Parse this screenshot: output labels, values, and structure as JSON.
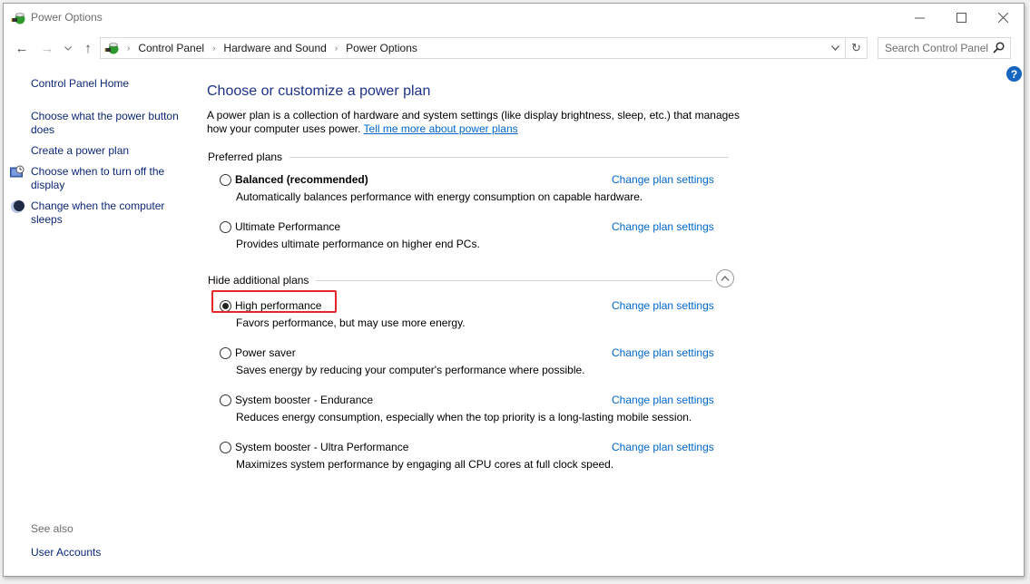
{
  "window": {
    "title": "Power Options",
    "controls": {
      "minimize": "—",
      "maximize": "☐",
      "close": "✕"
    }
  },
  "nav": {
    "back": "←",
    "forward": "→",
    "recent": "⌄",
    "up": "↑",
    "breadcrumb": [
      "Control Panel",
      "Hardware and Sound",
      "Power Options"
    ],
    "separator": "›",
    "dropdown": "⌄",
    "refresh": "↻",
    "search_placeholder": "Search Control Panel",
    "help": "?"
  },
  "sidebar": {
    "home": "Control Panel Home",
    "items": [
      {
        "label": "Choose what the power button does",
        "icon": null
      },
      {
        "label": "Create a power plan",
        "icon": null
      },
      {
        "label": "Choose when to turn off the display",
        "icon": "display-timer-icon"
      },
      {
        "label": "Change when the computer sleeps",
        "icon": "sleep-moon-icon"
      }
    ],
    "see_also": "See also",
    "see_also_links": [
      "User Accounts"
    ]
  },
  "main": {
    "title": "Choose or customize a power plan",
    "intro": "A power plan is a collection of hardware and system settings (like display brightness, sleep, etc.) that manages how your computer uses power.",
    "intro_link": "Tell me more about power plans",
    "preferred_header": "Preferred plans",
    "additional_header": "Hide additional plans",
    "collapse_glyph": "︿",
    "change_link": "Change plan settings",
    "preferred_plans": [
      {
        "name": "Balanced (recommended)",
        "desc": "Automatically balances performance with energy consumption on capable hardware.",
        "selected": false,
        "bold": true
      },
      {
        "name": "Ultimate Performance",
        "desc": "Provides ultimate performance on higher end PCs.",
        "selected": false,
        "bold": false
      }
    ],
    "additional_plans": [
      {
        "name": "High performance",
        "desc": "Favors performance, but may use more energy.",
        "selected": true,
        "bold": false
      },
      {
        "name": "Power saver",
        "desc": "Saves energy by reducing your computer's performance where possible.",
        "selected": false,
        "bold": false
      },
      {
        "name": "System booster - Endurance",
        "desc": "Reduces energy consumption, especially when the top priority is a long-lasting mobile session.",
        "selected": false,
        "bold": false
      },
      {
        "name": "System booster - Ultra Performance",
        "desc": "Maximizes system performance by engaging all CPU cores at full clock speed.",
        "selected": false,
        "bold": false
      }
    ]
  },
  "colors": {
    "link": "#0066cc",
    "title": "#1e3287",
    "sidebar_link": "#0c2775",
    "highlight": "#e5262b",
    "help": "#1564c0"
  }
}
